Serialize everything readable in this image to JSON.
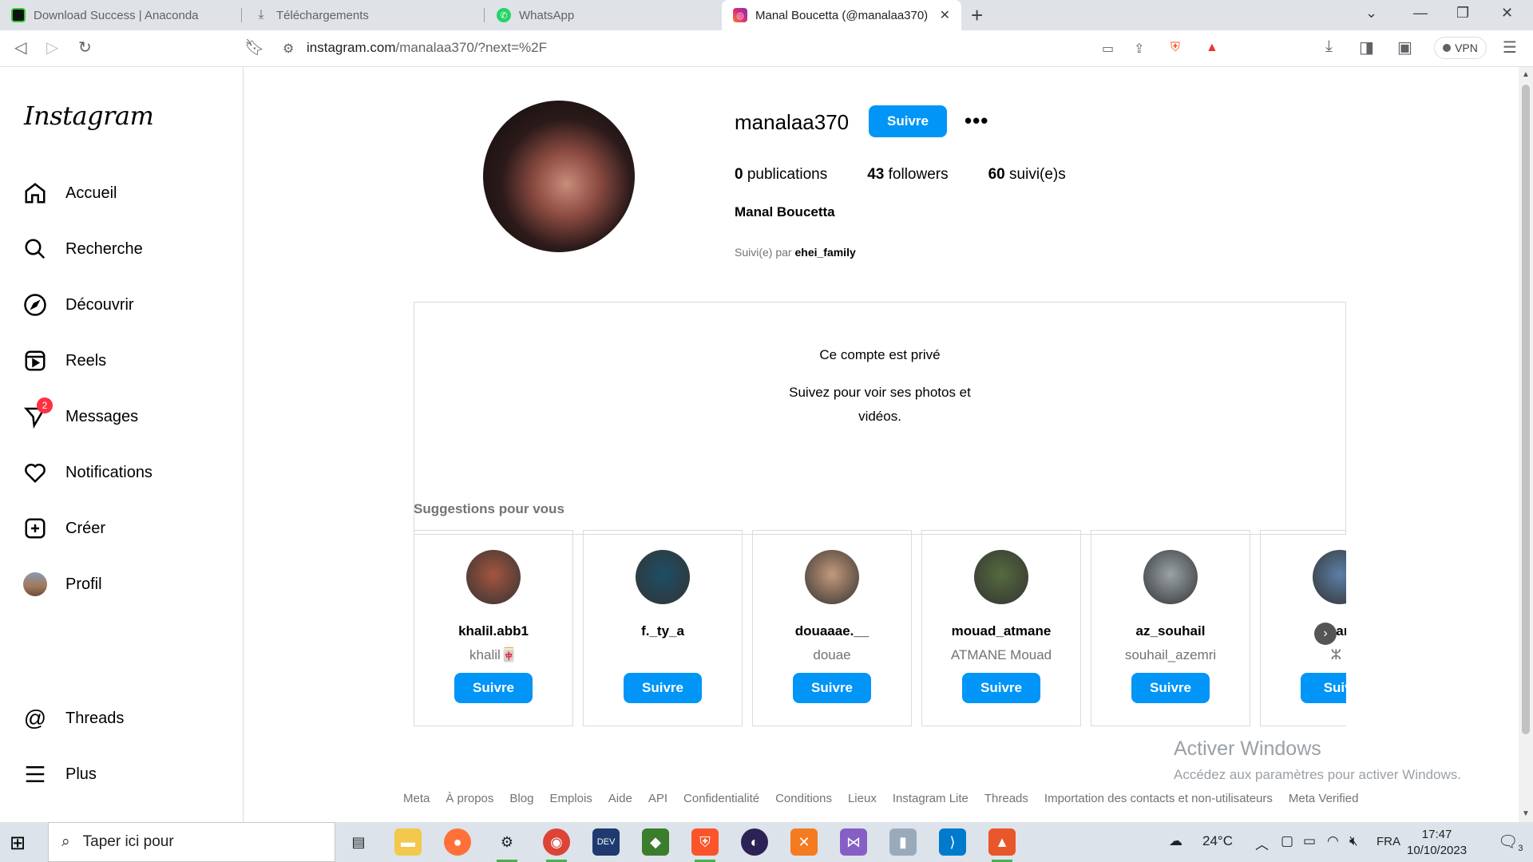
{
  "browser": {
    "tabs": [
      {
        "title": "Download Success | Anaconda",
        "active": false
      },
      {
        "title": "Téléchargements",
        "active": false
      },
      {
        "title": "WhatsApp",
        "active": false
      },
      {
        "title": "Manal Boucetta (@manalaa370)",
        "active": true
      }
    ],
    "url_domain": "instagram.com",
    "url_path": "/manalaa370/?next=%2F",
    "vpn_label": "VPN"
  },
  "sidebar": {
    "logo": "Instagram",
    "items": [
      {
        "label": "Accueil",
        "icon": "home-icon"
      },
      {
        "label": "Recherche",
        "icon": "search-icon"
      },
      {
        "label": "Découvrir",
        "icon": "compass-icon"
      },
      {
        "label": "Reels",
        "icon": "reels-icon"
      },
      {
        "label": "Messages",
        "icon": "messenger-icon",
        "badge": "2"
      },
      {
        "label": "Notifications",
        "icon": "heart-icon"
      },
      {
        "label": "Créer",
        "icon": "plus-square-icon"
      },
      {
        "label": "Profil",
        "icon": "avatar"
      }
    ],
    "bottom": [
      {
        "label": "Threads",
        "icon": "threads-icon"
      },
      {
        "label": "Plus",
        "icon": "menu-icon"
      }
    ]
  },
  "profile": {
    "username": "manalaa370",
    "follow_label": "Suivre",
    "posts_count": "0",
    "posts_label": "publications",
    "followers_count": "43",
    "followers_label": "followers",
    "following_count": "60",
    "following_label": "suivi(e)s",
    "full_name": "Manal Boucetta",
    "followed_by_prefix": "Suivi(e) par",
    "followed_by_user": "ehei_family"
  },
  "private": {
    "title": "Ce compte est privé",
    "subtitle": "Suivez pour voir ses photos et vidéos."
  },
  "suggestions": {
    "title": "Suggestions pour vous",
    "cards": [
      {
        "username": "khalil.abb1",
        "subtitle": "khalil🀄",
        "button": "Suivre",
        "color": "#a5553f"
      },
      {
        "username": "f._ty_a",
        "subtitle": "",
        "button": "Suivre",
        "color": "#1d4f66"
      },
      {
        "username": "douaaae.__",
        "subtitle": "douae",
        "button": "Suivre",
        "color": "#c49a7a"
      },
      {
        "username": "mouad_atmane",
        "subtitle": "ATMANE Mouad",
        "button": "Suivre",
        "color": "#556b3d"
      },
      {
        "username": "az_souhail",
        "subtitle": "souhail_azemri",
        "button": "Suivre",
        "color": "#9aa3a8"
      },
      {
        "username": "omar_e",
        "subtitle": "ⵣ ,",
        "button": "Suivi",
        "color": "#5c7fa6"
      }
    ]
  },
  "footer": {
    "links": [
      "Meta",
      "À propos",
      "Blog",
      "Emplois",
      "Aide",
      "API",
      "Confidentialité",
      "Conditions",
      "Lieux",
      "Instagram Lite",
      "Threads",
      "Importation des contacts et non-utilisateurs",
      "Meta Verified"
    ]
  },
  "watermark": {
    "title": "Activer Windows",
    "subtitle": "Accédez aux paramètres pour activer Windows."
  },
  "taskbar": {
    "search_placeholder": "Taper ici pour",
    "weather": "24°C",
    "language": "FRA",
    "time": "17:47",
    "date": "10/10/2023",
    "notification_count": "3"
  }
}
